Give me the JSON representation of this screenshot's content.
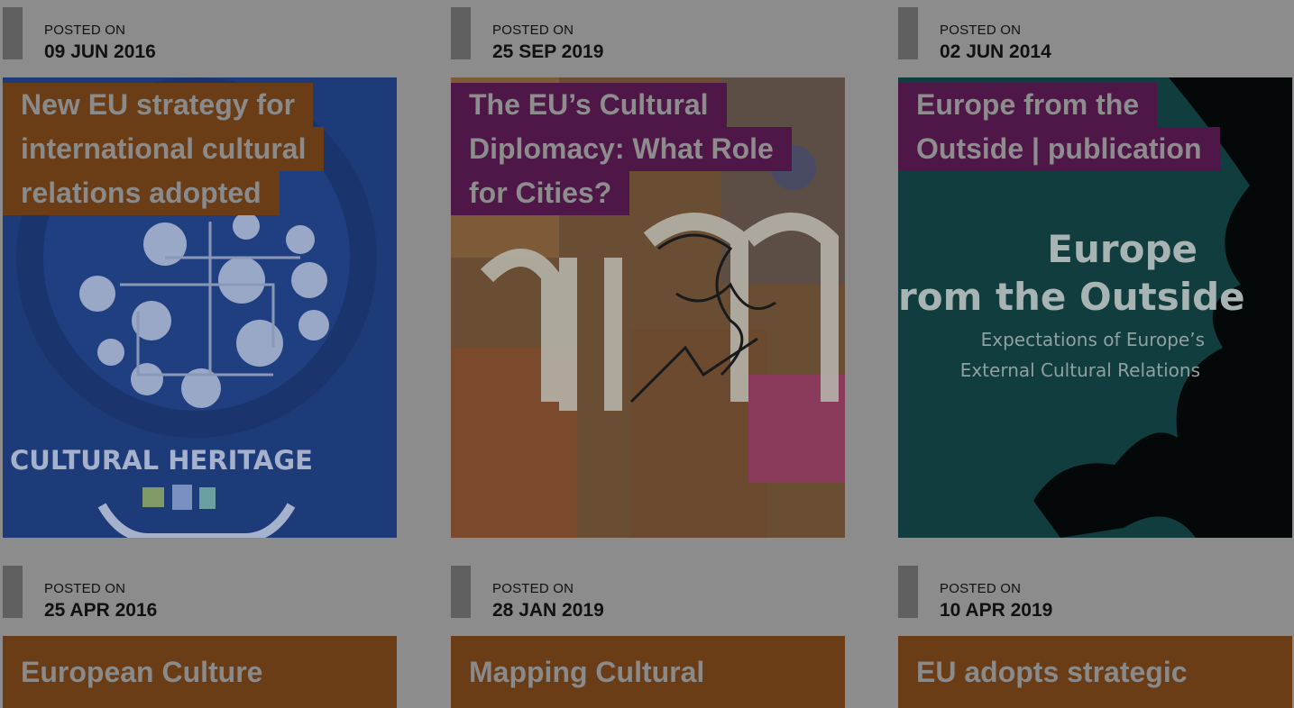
{
  "posts": [
    {
      "label": "POSTED ON",
      "date": "09 JUN 2016",
      "title_lines": [
        "New EU strategy for",
        "international cultural",
        "relations adopted"
      ],
      "image_text": "CULTURAL HERITAGE",
      "accent": "#6b3d17"
    },
    {
      "label": "POSTED ON",
      "date": "25 SEP 2019",
      "title_lines": [
        "The EU’s Cultural",
        "Diplomacy: What Role",
        "for Cities?"
      ],
      "accent": "#4f1648"
    },
    {
      "label": "POSTED ON",
      "date": "02 JUN 2014",
      "title_lines": [
        "Europe from the",
        "Outside | publication"
      ],
      "image_title_1": "Europe",
      "image_title_2": "rom the Outside",
      "image_sub_1": "Expectations of Europe’s",
      "image_sub_2": "External Cultural Relations",
      "accent": "#4f1648"
    },
    {
      "label": "POSTED ON",
      "date": "25 APR 2016",
      "title": "European Culture",
      "accent": "#6b3d17"
    },
    {
      "label": "POSTED ON",
      "date": "28 JAN 2019",
      "title": "Mapping Cultural",
      "accent": "#6b3d17"
    },
    {
      "label": "POSTED ON",
      "date": "10 APR 2019",
      "title": "EU adopts strategic",
      "accent": "#6b3d17"
    }
  ]
}
